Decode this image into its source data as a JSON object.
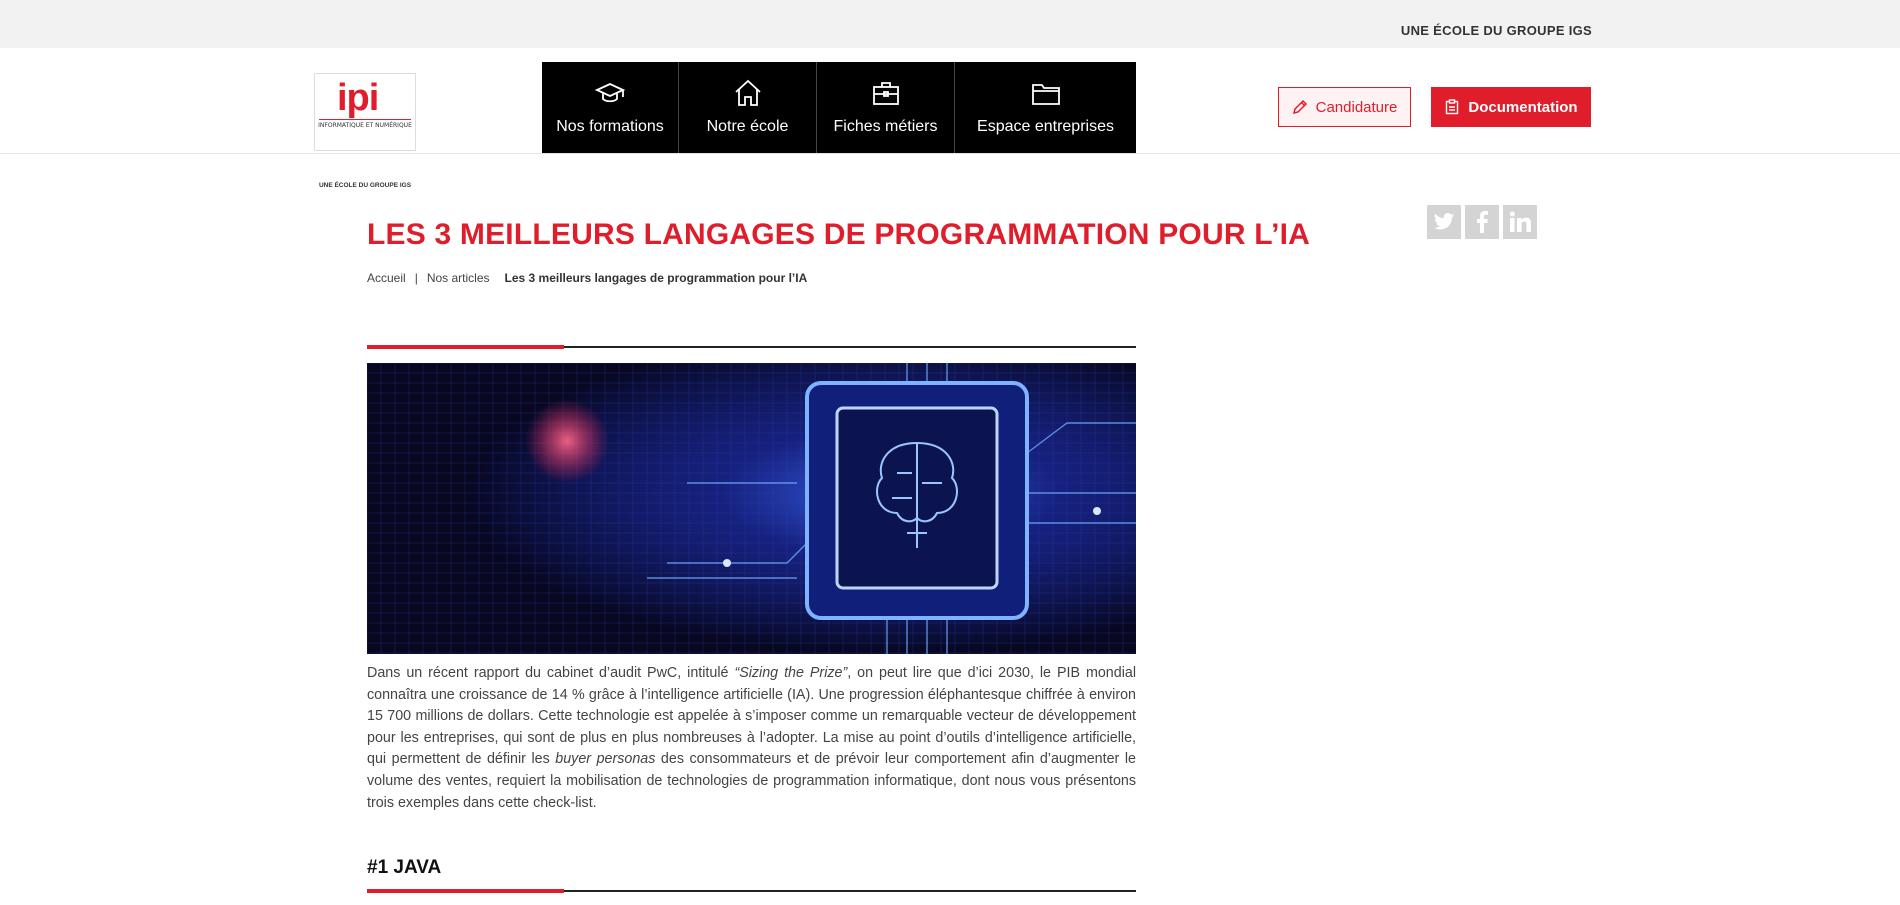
{
  "topbar": {
    "group_label": "UNE ÉCOLE DU GROUPE IGS"
  },
  "logo": {
    "brand": "ipi",
    "tagline": "INFORMATIQUE ET NUMÉRIQUE",
    "group": "UNE ÉCOLE DU GROUPE IGS"
  },
  "nav": {
    "items": [
      {
        "label": "Nos formations",
        "icon": "graduation-cap-icon"
      },
      {
        "label": "Notre école",
        "icon": "home-icon"
      },
      {
        "label": "Fiches métiers",
        "icon": "briefcase-icon"
      },
      {
        "label": "Espace entreprises",
        "icon": "folder-icon"
      }
    ]
  },
  "actions": {
    "candidature": "Candidature",
    "documentation": "Documentation"
  },
  "share": {
    "icons": [
      "twitter-icon",
      "facebook-icon",
      "linkedin-icon"
    ]
  },
  "page": {
    "title": "LES 3 MEILLEURS LANGAGES DE PROGRAMMATION POUR L’IA",
    "breadcrumb": {
      "home": "Accueil",
      "separator": "|",
      "section": "Nos articles",
      "current": "Les 3 meilleurs langages de programmation pour l’IA"
    }
  },
  "article": {
    "intro_1": "Dans un récent rapport du cabinet d’audit PwC, intitulé ",
    "intro_em_1": "“Sizing the Prize”",
    "intro_2": ", on peut lire que d’ici 2030, le PIB mondial connaîtra une croissance de 14 % grâce à l’intelligence artificielle (IA). Une progression éléphantesque chiffrée à environ 15 700 millions de dollars. Cette technologie est appelée à s’imposer comme un remarquable vecteur de développement pour les entreprises, qui sont de plus en plus nombreuses à l’adopter. La mise au point d’outils d’intelligence artificielle, qui permettent de définir les ",
    "intro_em_2": "buyer personas",
    "intro_3": " des consommateurs et de prévoir leur comportement afin d’augmenter le volume des ventes, requiert la mobilisation de technologies de programmation informatique, dont nous vous présentons trois exemples dans cette check-list.",
    "section_1": "#1 JAVA"
  },
  "colors": {
    "brand_red": "#e01d2b",
    "nav_bg": "#000000"
  }
}
